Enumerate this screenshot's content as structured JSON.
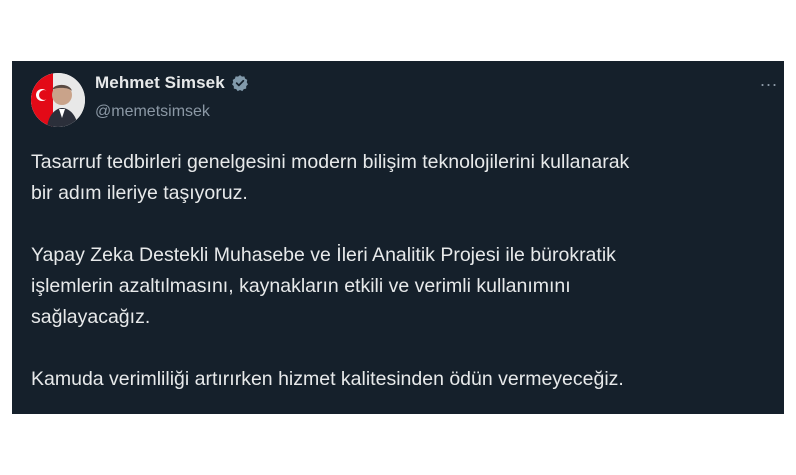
{
  "tweet": {
    "author_name": "Mehmet Simsek",
    "author_handle": "@memetsimsek",
    "verified": true,
    "more_label": "...",
    "paragraphs": [
      {
        "lines": [
          "Tasarruf tedbirleri genelgesini modern bilişim teknolojilerini kullanarak",
          "bir adım ileriye taşıyoruz."
        ]
      },
      {
        "lines": [
          "Yapay Zeka Destekli Muhasebe ve İleri Analitik Projesi ile bürokratik",
          "işlemlerin azaltılmasını, kaynakların etkili ve verimli kullanımını",
          "sağlayacağız."
        ]
      },
      {
        "lines": [
          "Kamuda verimliliği artırırken hizmet kalitesinden ödün vermeyeceğiz."
        ]
      }
    ]
  },
  "colors": {
    "card_background": "#15202b",
    "text_primary": "#e7e9ea",
    "text_secondary": "#8b98a5",
    "verified_badge": "#829aab"
  }
}
